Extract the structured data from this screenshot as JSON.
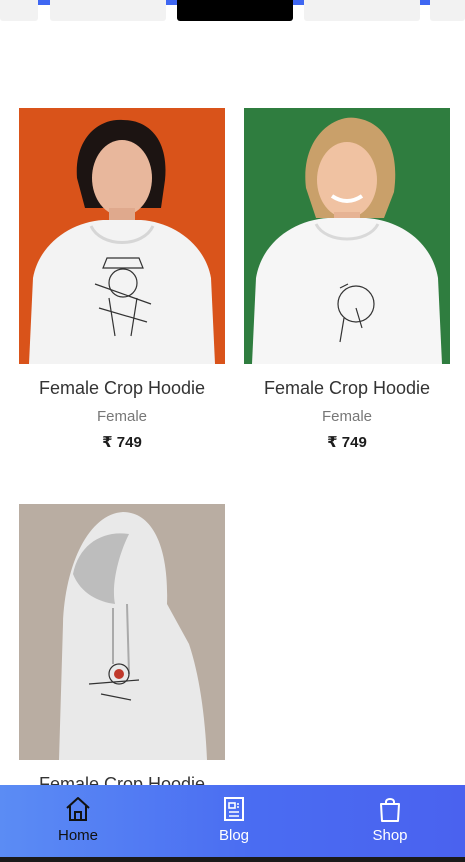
{
  "products": [
    {
      "title": "Female Crop Hoodie",
      "category": "Female",
      "price": "₹ 749",
      "backdrop": "#d9531a"
    },
    {
      "title": "Female Crop Hoodie",
      "category": "Female",
      "price": "₹ 749",
      "backdrop": "#2f7d3f"
    },
    {
      "title": "Female Crop Hoodie",
      "backdrop": "#b9ada2"
    }
  ],
  "nav": [
    {
      "label": "Home",
      "icon": "home-icon",
      "active": true
    },
    {
      "label": "Blog",
      "icon": "blog-icon",
      "active": false
    },
    {
      "label": "Shop",
      "icon": "shopping-bag-icon",
      "active": false
    }
  ],
  "colors": {
    "accent": "#3f67f2",
    "nav_background": "#4a6cf2"
  }
}
